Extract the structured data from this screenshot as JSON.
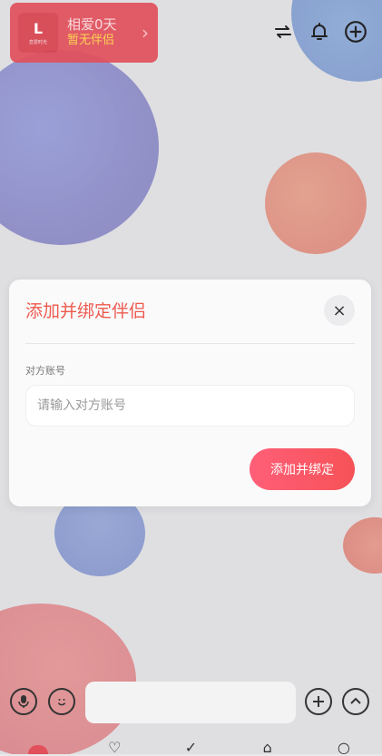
{
  "badge": {
    "avatar_letter": "L",
    "avatar_caption": "恋爱时光",
    "days_text": "相爱0天",
    "partner_text": "暂无伴侣",
    "chevron": "›"
  },
  "top_icons": [
    "swap-icon",
    "bell-icon",
    "add-circle-icon"
  ],
  "modal": {
    "title": "添加并绑定伴侣",
    "close_symbol": "×",
    "field_label": "对方账号",
    "field_placeholder": "请输入对方账号",
    "submit_label": "添加并绑定"
  },
  "chatbar": {
    "left_icons": [
      "mic-icon",
      "emoji-icon"
    ],
    "right_icons": [
      "plus-circle-icon",
      "chevron-up-circle-icon"
    ]
  },
  "colors": {
    "accent": "#ee5a4f",
    "badge": "#e2505c",
    "partner_text": "#ffd44a"
  }
}
